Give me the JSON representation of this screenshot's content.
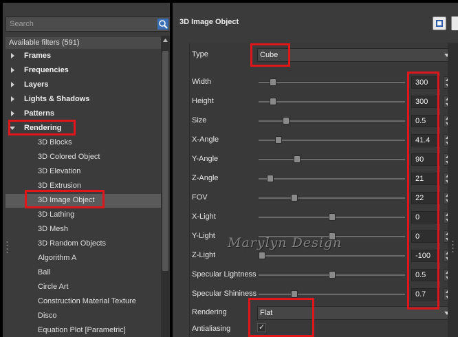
{
  "left_panel": {
    "search_placeholder": "Search",
    "header": "Available filters (591)",
    "categories": [
      {
        "label": "Frames",
        "expanded": false
      },
      {
        "label": "Frequencies",
        "expanded": false
      },
      {
        "label": "Layers",
        "expanded": false
      },
      {
        "label": "Lights & Shadows",
        "expanded": false
      },
      {
        "label": "Patterns",
        "expanded": false
      },
      {
        "label": "Rendering",
        "expanded": true
      }
    ],
    "items": [
      "3D Blocks",
      "3D Colored Object",
      "3D Elevation",
      "3D Extrusion",
      "3D Image Object",
      "3D Lathing",
      "3D Mesh",
      "3D Random Objects",
      "Algorithm A",
      "Ball",
      "Circle Art",
      "Construction Material Texture",
      "Disco",
      "Equation Plot [Parametric]"
    ],
    "selected_item": "3D Image Object"
  },
  "right_panel": {
    "title": "3D Image Object",
    "type": {
      "label": "Type",
      "value": "Cube"
    },
    "params": [
      {
        "label": "Width",
        "value": "300",
        "level": 0.08
      },
      {
        "label": "Height",
        "value": "300",
        "level": 0.08
      },
      {
        "label": "Size",
        "value": "0.5",
        "level": 0.17
      },
      {
        "label": "X-Angle",
        "value": "41.4",
        "level": 0.12
      },
      {
        "label": "Y-Angle",
        "value": "90",
        "level": 0.25
      },
      {
        "label": "Z-Angle",
        "value": "21",
        "level": 0.06
      },
      {
        "label": "FOV",
        "value": "22",
        "level": 0.23
      },
      {
        "label": "X-Light",
        "value": "0",
        "level": 0.5
      },
      {
        "label": "Y-Light",
        "value": "0",
        "level": 0.5
      },
      {
        "label": "Z-Light",
        "value": "-100",
        "level": 0.0
      },
      {
        "label": "Specular Lightness",
        "value": "0.5",
        "level": 0.5
      },
      {
        "label": "Specular Shininess",
        "value": "0.7",
        "level": 0.23
      }
    ],
    "rendering": {
      "label": "Rendering",
      "value": "Flat"
    },
    "antialiasing": {
      "label": "Antialiasing",
      "checked": true,
      "check_glyph": "✓"
    }
  },
  "watermark": "Marylyn Design",
  "colors": {
    "panel": "#3b3b3b",
    "highlight_box": "#e0161b",
    "selected_row": "#5a5a5a"
  }
}
